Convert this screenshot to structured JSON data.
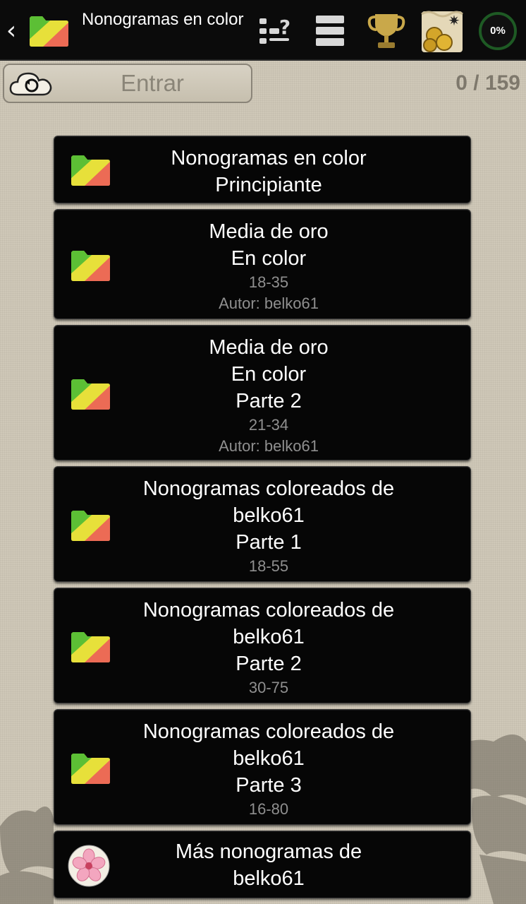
{
  "header": {
    "title": "Nonogramas en color",
    "progress": "0%",
    "icons": [
      "back-arrow-icon",
      "folder-icon",
      "filter-unsolved-icon",
      "list-icon",
      "trophy-icon",
      "coins-map-icon"
    ]
  },
  "login": {
    "label": "Entrar",
    "icon": "cloud-sync-icon"
  },
  "counter": "0 / 159",
  "colors": {
    "topbar": "#0b0b0b",
    "item_bg": "#060606",
    "folder_yellow": "#e7e03a",
    "folder_green": "#5cbf35",
    "folder_red": "#ec6b55"
  },
  "items": [
    {
      "lines": [
        "Nonogramas en color",
        "Principiante"
      ],
      "subs": []
    },
    {
      "lines": [
        "Media de oro",
        "En color"
      ],
      "subs": [
        "18-35",
        "Autor: belko61"
      ]
    },
    {
      "lines": [
        "Media de oro",
        "En color",
        "Parte 2"
      ],
      "subs": [
        "21-34",
        "Autor: belko61"
      ]
    },
    {
      "lines": [
        "Nonogramas coloreados de",
        "belko61",
        "Parte 1"
      ],
      "subs": [
        "18-55"
      ]
    },
    {
      "lines": [
        "Nonogramas coloreados de",
        "belko61",
        "Parte 2"
      ],
      "subs": [
        "30-75"
      ]
    },
    {
      "lines": [
        "Nonogramas coloreados de",
        "belko61",
        "Parte 3"
      ],
      "subs": [
        "16-80"
      ]
    },
    {
      "lines": [
        "Más nonogramas de",
        "belko61"
      ],
      "subs": [],
      "icon": "flower-icon"
    }
  ]
}
